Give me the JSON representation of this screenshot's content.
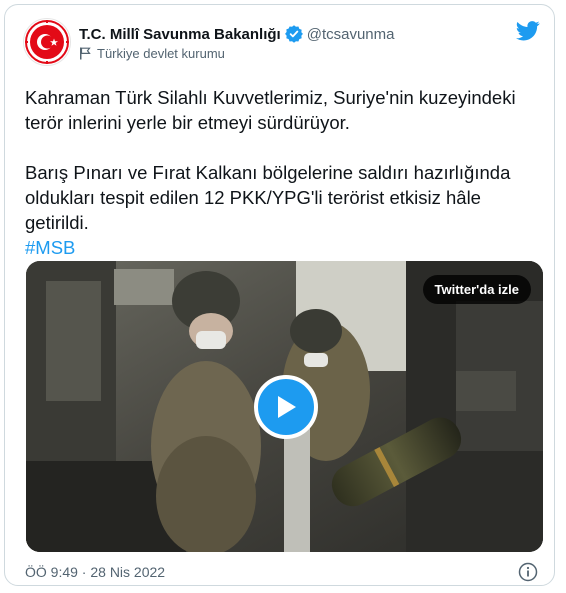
{
  "account": {
    "display_name": "T.C. Millî Savunma Bakanlığı",
    "handle": "@tcsavunma",
    "label": "Türkiye devlet kurumu"
  },
  "tweet": {
    "line1": "Kahraman Türk Silahlı Kuvvetlerimiz, Suriye'nin kuzeyindeki",
    "line2": "terör inlerini yerle bir etmeyi sürdürüyor.",
    "line3": "Barış Pınarı ve Fırat Kalkanı bölgelerine saldırı hazırlığında",
    "line4": "oldukları tespit edilen 12 PKK/YPG'li terörist etkisiz hâle",
    "line5": "getirildi.",
    "hashtag": "#MSB"
  },
  "media": {
    "watch_label": "Twitter'da izle"
  },
  "footer": {
    "timestamp": "ÖÖ 9:49 · 28 Nis 2022"
  },
  "colors": {
    "accent": "#1d9bf0",
    "text": "#0f1419",
    "secondary": "#536471",
    "border": "#cfd9de",
    "logo_red": "#e30a17"
  },
  "icons": [
    "msb-logo",
    "verified-badge-icon",
    "flag-icon",
    "twitter-bird-icon",
    "play-icon",
    "info-icon"
  ]
}
